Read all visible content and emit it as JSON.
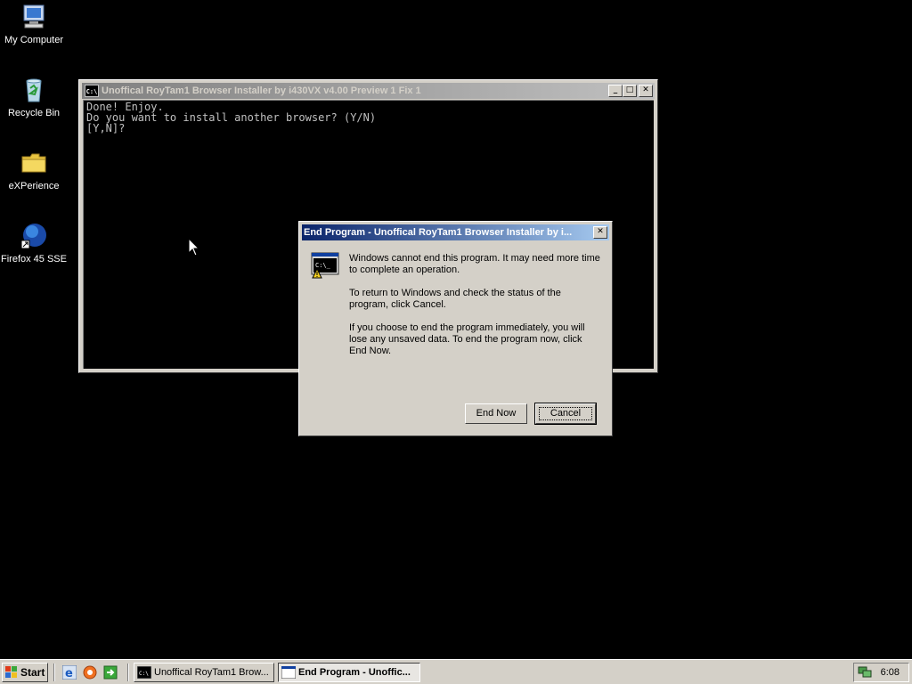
{
  "desktop": {
    "icons": [
      {
        "label": "My Computer",
        "icon": "my-computer-icon"
      },
      {
        "label": "Recycle Bin",
        "icon": "recycle-bin-icon"
      },
      {
        "label": "eXPerience",
        "icon": "folder-icon"
      },
      {
        "label": "Firefox 45 SSE",
        "icon": "firefox-icon"
      }
    ]
  },
  "console": {
    "title": "Unoffical RoyTam1 Browser Installer by i430VX v4.00 Preview 1 Fix 1",
    "lines": "Done! Enjoy.\nDo you want to install another browser? (Y/N)\n[Y,N]?",
    "icon_text": "C:\\"
  },
  "dialog": {
    "title": "End Program - Unoffical RoyTam1 Browser Installer by i...",
    "paragraph1": "Windows cannot end this program. It may need more time to complete an operation.",
    "paragraph2": "To return to Windows and check the status of the program, click Cancel.",
    "paragraph3": "If you choose to end the program immediately, you will lose any unsaved data. To end the program now, click End Now.",
    "end_now_label": "End Now",
    "cancel_label": "Cancel",
    "icon_text": "C:\\_"
  },
  "taskbar": {
    "start_label": "Start",
    "tasks": [
      {
        "label": "Unoffical RoyTam1 Brow...",
        "active": false
      },
      {
        "label": "End Program - Unoffic...",
        "active": true
      }
    ],
    "clock": "6:08"
  },
  "colors": {
    "desktop": "#000000",
    "active_title_start": "#0a246a",
    "active_title_end": "#a6caf0",
    "inactive_title_start": "#808080",
    "inactive_title_end": "#c0c0c0",
    "face": "#d4d0c8"
  }
}
